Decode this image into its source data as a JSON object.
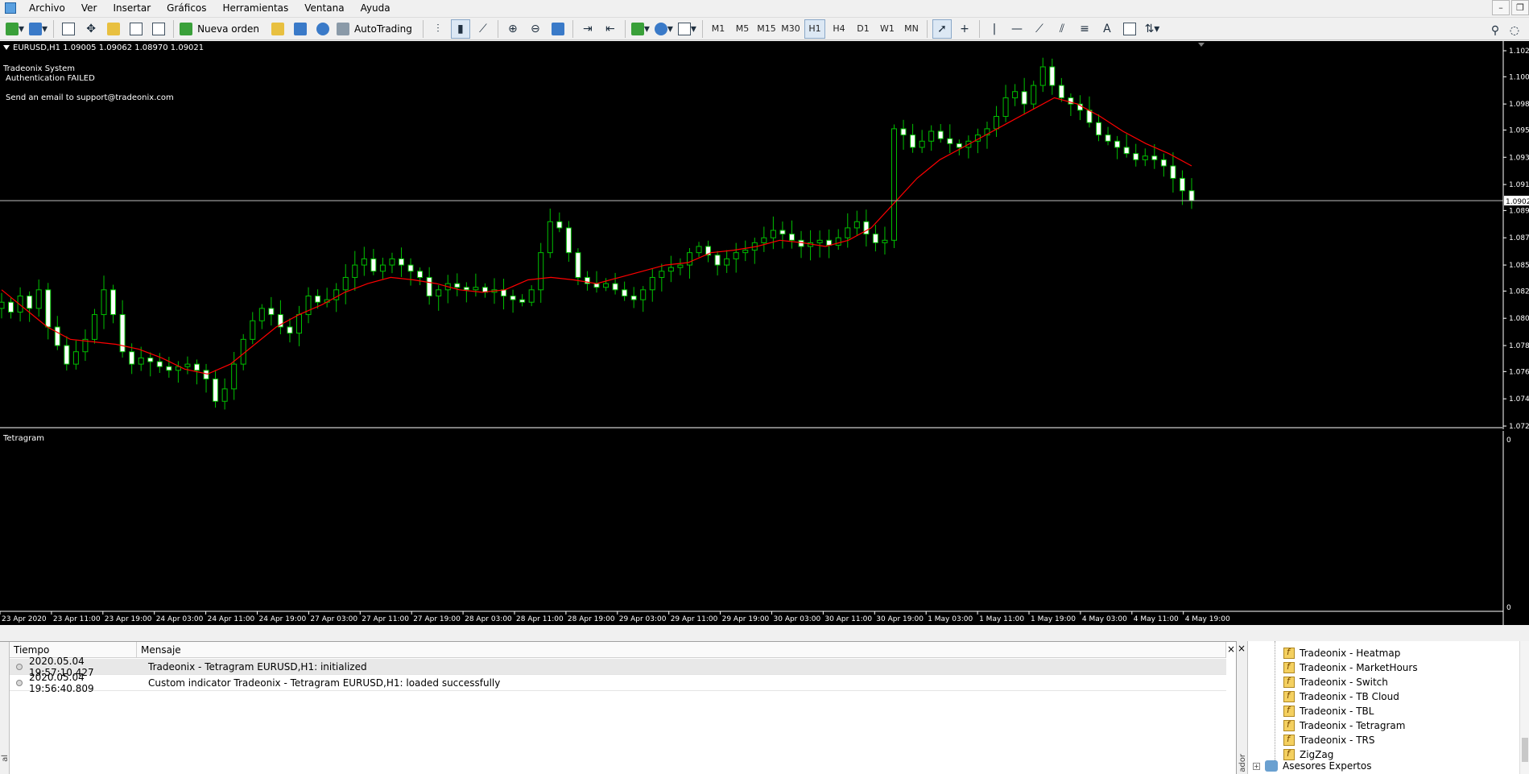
{
  "menu": {
    "items": [
      "Archivo",
      "Ver",
      "Insertar",
      "Gráficos",
      "Herramientas",
      "Ventana",
      "Ayuda"
    ],
    "window_buttons": [
      "–",
      "❐"
    ]
  },
  "toolbar": {
    "new_order_label": "Nueva orden",
    "autotrading_label": "AutoTrading",
    "timeframes": [
      "M1",
      "M5",
      "M15",
      "M30",
      "H1",
      "H4",
      "D1",
      "W1",
      "MN"
    ],
    "active_timeframe": "H1",
    "text_tool_label": "A"
  },
  "chart": {
    "header": "EURUSD,H1  1.09005 1.09062 1.08970 1.09021",
    "overlay_line1": "Tradeonix System",
    "overlay_line2": "Authentication FAILED",
    "overlay_line3": "Send an email to support@tradeonix.com",
    "current_price_label": "1.0902",
    "indicator_label": "Tetragram",
    "indicator_scale_top": "0",
    "indicator_scale_bottom": "0",
    "colors": {
      "background": "#000000",
      "candle_up": "#ffffff",
      "candle_down": "#ffffff",
      "wick": "#00c000",
      "ma_line": "#ff0000",
      "text": "#ffffff"
    }
  },
  "chart_data": {
    "type": "candlestick",
    "price_ticks": [
      "1.1023",
      "1.1002",
      "1.0980",
      "1.0959",
      "1.0937",
      "1.0915",
      "1.0894",
      "1.0872",
      "1.0850",
      "1.0829",
      "1.0807",
      "1.0785",
      "1.0764",
      "1.0742",
      "1.0720"
    ],
    "ylim": [
      1.072,
      1.1023
    ],
    "time_labels": [
      "23 Apr 2020",
      "23 Apr 11:00",
      "23 Apr 19:00",
      "24 Apr 03:00",
      "24 Apr 11:00",
      "24 Apr 19:00",
      "27 Apr 03:00",
      "27 Apr 11:00",
      "27 Apr 19:00",
      "28 Apr 03:00",
      "28 Apr 11:00",
      "28 Apr 19:00",
      "29 Apr 03:00",
      "29 Apr 11:00",
      "29 Apr 19:00",
      "30 Apr 03:00",
      "30 Apr 11:00",
      "30 Apr 19:00",
      "1 May 03:00",
      "1 May 11:00",
      "1 May 19:00",
      "4 May 03:00",
      "4 May 11:00",
      "4 May 19:00"
    ],
    "current_price": 1.0902,
    "close_path": [
      1.082,
      1.0812,
      1.0825,
      1.0815,
      1.083,
      1.08,
      1.0785,
      1.077,
      1.078,
      1.079,
      1.081,
      1.083,
      1.081,
      1.078,
      1.077,
      1.0775,
      1.0772,
      1.0768,
      1.0765,
      1.0768,
      1.077,
      1.0765,
      1.0758,
      1.074,
      1.075,
      1.077,
      1.079,
      1.0805,
      1.0815,
      1.081,
      1.08,
      1.0795,
      1.081,
      1.0825,
      1.082,
      1.0822,
      1.083,
      1.084,
      1.085,
      1.0855,
      1.0845,
      1.085,
      1.0855,
      1.085,
      1.0845,
      1.084,
      1.0825,
      1.083,
      1.0835,
      1.0832,
      1.083,
      1.0832,
      1.0828,
      1.083,
      1.0825,
      1.0822,
      1.082,
      1.083,
      1.086,
      1.0885,
      1.088,
      1.086,
      1.084,
      1.0835,
      1.0832,
      1.0835,
      1.083,
      1.0825,
      1.0822,
      1.083,
      1.084,
      1.0845,
      1.0848,
      1.085,
      1.086,
      1.0865,
      1.0858,
      1.085,
      1.0855,
      1.086,
      1.0862,
      1.0868,
      1.0872,
      1.0878,
      1.0875,
      1.087,
      1.0865,
      1.0868,
      1.087,
      1.0866,
      1.0872,
      1.088,
      1.0885,
      1.0875,
      1.0868,
      1.087,
      1.096,
      1.0955,
      1.0945,
      1.095,
      1.0958,
      1.0952,
      1.0948,
      1.0945,
      1.095,
      1.0955,
      1.096,
      1.097,
      1.0985,
      1.099,
      1.098,
      1.0995,
      1.101,
      1.0995,
      1.0985,
      1.098,
      1.0975,
      1.0965,
      1.0955,
      1.095,
      1.0945,
      1.094,
      1.0935,
      1.0938,
      1.0935,
      1.093,
      1.092,
      1.091,
      1.0902
    ],
    "ma_path": [
      1.083,
      1.0815,
      1.08,
      1.079,
      1.0788,
      1.0786,
      1.0782,
      1.0775,
      1.0766,
      1.0762,
      1.077,
      1.0785,
      1.08,
      1.081,
      1.0818,
      1.0828,
      1.0835,
      1.084,
      1.0838,
      1.0835,
      1.083,
      1.0828,
      1.083,
      1.0838,
      1.084,
      1.0838,
      1.0835,
      1.084,
      1.0845,
      1.085,
      1.0852,
      1.086,
      1.0862,
      1.0865,
      1.087,
      1.0868,
      1.0865,
      1.087,
      1.088,
      1.09,
      1.092,
      1.0935,
      1.0945,
      1.0955,
      1.0965,
      1.0975,
      1.0985,
      1.098,
      1.097,
      1.0958,
      1.0948,
      1.094,
      1.093
    ],
    "indicator": {
      "name": "Tetragram",
      "values": []
    }
  },
  "terminal": {
    "columns": [
      "Tiempo",
      "Mensaje"
    ],
    "rows": [
      {
        "time": "2020.05.04 19:57:10.427",
        "message": "Tradeonix - Tetragram EURUSD,H1: initialized"
      },
      {
        "time": "2020.05.04 19:56:40.809",
        "message": "Custom indicator Tradeonix - Tetragram EURUSD,H1: loaded successfully"
      }
    ],
    "close_label": "×",
    "strip_label": "al"
  },
  "navigator": {
    "items": [
      "Tradeonix - Heatmap",
      "Tradeonix - MarketHours",
      "Tradeonix - Switch",
      "Tradeonix - TB Cloud",
      "Tradeonix - TBL",
      "Tradeonix - Tetragram",
      "Tradeonix - TRS",
      "ZigZag"
    ],
    "experts_label": "Asesores Expertos",
    "close_label": "×",
    "strip_label": "ador",
    "expand_glyph": "+"
  }
}
